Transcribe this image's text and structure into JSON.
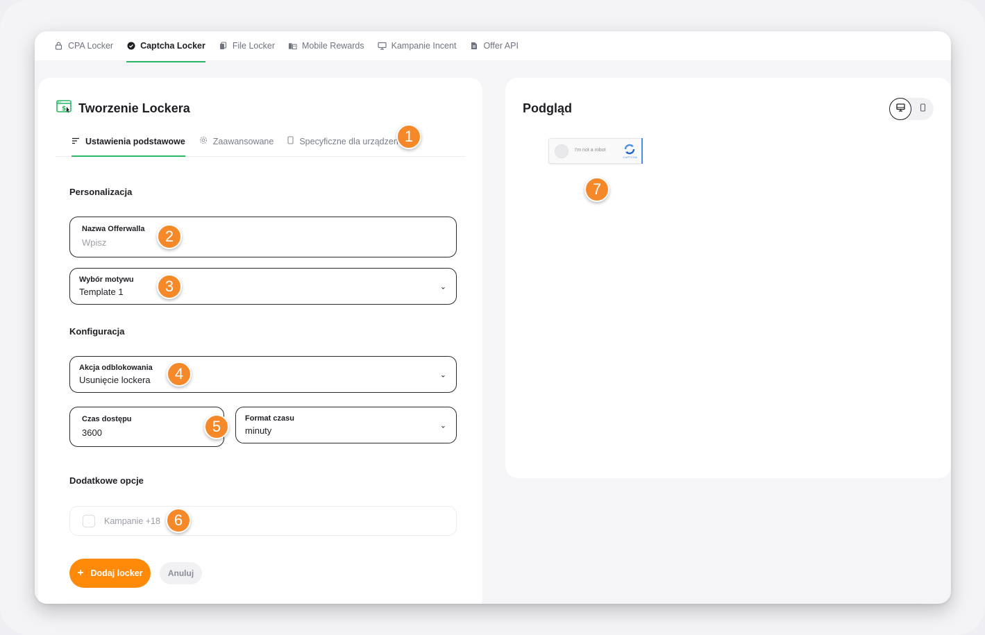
{
  "nav": {
    "items": [
      {
        "label": "CPA Locker",
        "icon": "lock-icon"
      },
      {
        "label": "Captcha Locker",
        "icon": "check-circle-icon"
      },
      {
        "label": "File Locker",
        "icon": "files-icon"
      },
      {
        "label": "Mobile Rewards",
        "icon": "buildings-icon"
      },
      {
        "label": "Kampanie Incent",
        "icon": "monitor-icon"
      },
      {
        "label": "Offer API",
        "icon": "document-icon"
      }
    ],
    "active_index": 1
  },
  "form": {
    "title": "Tworzenie Lockera",
    "tabs": [
      {
        "label": "Ustawienia podstawowe",
        "icon": "sort-lines-icon"
      },
      {
        "label": "Zaawansowane",
        "icon": "gear-icon"
      },
      {
        "label": "Specyficzne dla urządzenia",
        "icon": "phone-icon"
      }
    ],
    "section_personalization": "Personalizacja",
    "offerwall_name": {
      "label": "Nazwa Offerwalla",
      "placeholder": "Wpisz",
      "value": ""
    },
    "theme": {
      "label": "Wybór motywu",
      "value": "Template 1"
    },
    "section_configuration": "Konfiguracja",
    "unlock_action": {
      "label": "Akcja odblokowania",
      "value": "Usunięcie lockera"
    },
    "access_time": {
      "label": "Czas dostępu",
      "value": "3600"
    },
    "time_format": {
      "label": "Format czasu",
      "value": "minuty"
    },
    "section_additional": "Dodatkowe opcje",
    "adult_campaigns": {
      "label": "Kampanie +18",
      "checked": false
    },
    "add_button": "Dodaj locker",
    "cancel_button": "Anuluj"
  },
  "preview": {
    "title": "Podgląd",
    "captcha_text": "I'm not a robot",
    "captcha_brand": "CAPTCHA"
  },
  "badges": [
    "1",
    "2",
    "3",
    "4",
    "5",
    "6",
    "7"
  ],
  "colors": {
    "accent_green": "#29b765",
    "primary_orange": "#ff8a0a",
    "badge_orange": "#f5892a",
    "captcha_blue": "#4a90e2"
  }
}
